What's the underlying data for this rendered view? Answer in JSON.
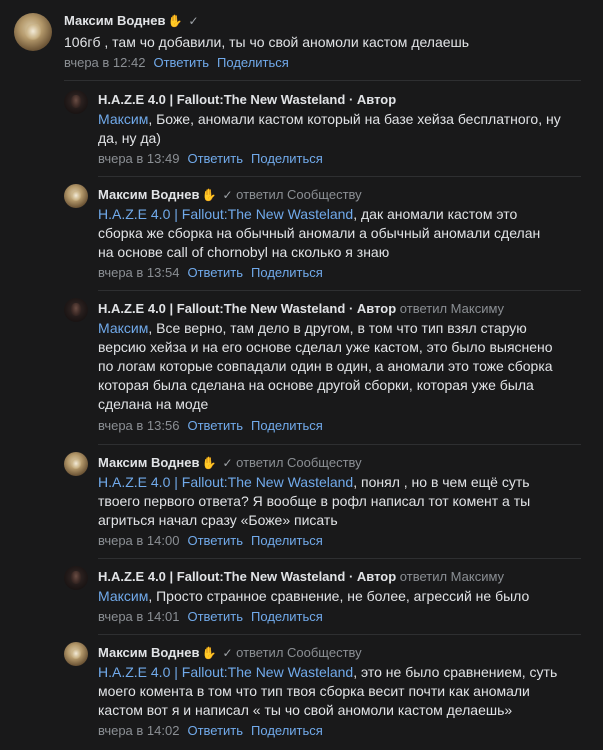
{
  "top": {
    "author": "Максим Воднев",
    "text": "106гб , там чо добавили, ты чо свой аномоли кастом делаешь",
    "time": "вчера в 12:42",
    "reply": "Ответить",
    "share": "Поделиться"
  },
  "replies": [
    {
      "author": "H.A.Z.E 4.0 | Fallout:The New Wasteland",
      "role": "· Автор",
      "replied": "",
      "mention": "Максим",
      "text": ", Боже, аномали кастом который на базе хейза бесплатного, ну да, ну да)",
      "time": "вчера в 13:49",
      "reply": "Ответить",
      "share": "Поделиться"
    },
    {
      "author": "Максим Воднев",
      "role": "",
      "replied": "ответил Сообществу",
      "mention": "H.A.Z.E 4.0 | Fallout:The New Wasteland",
      "text": ", дак аномали кастом это сборка же сборка на обычный аномали а обычный аномали сделан на основе call of chornobyl на сколько я знаю",
      "time": "вчера в 13:54",
      "reply": "Ответить",
      "share": "Поделиться"
    },
    {
      "author": "H.A.Z.E 4.0 | Fallout:The New Wasteland",
      "role": "· Автор",
      "replied": "ответил Максиму",
      "mention": "Максим",
      "text": ", Все верно, там дело в другом, в том что тип взял старую версию хейза и на его основе сделал уже кастом, это было выяснено по логам которые совпадали один в один, а аномали это тоже сборка которая была сделана на основе другой сборки, которая уже была сделана на моде",
      "time": "вчера в 13:56",
      "reply": "Ответить",
      "share": "Поделиться"
    },
    {
      "author": "Максим Воднев",
      "role": "",
      "replied": "ответил Сообществу",
      "mention": "H.A.Z.E 4.0 | Fallout:The New Wasteland",
      "text": ", понял , но в чем ещё суть твоего первого ответа? Я вообще в рофл написал тот комент а ты агриться начал сразу «Боже» писать",
      "time": "вчера в 14:00",
      "reply": "Ответить",
      "share": "Поделиться"
    },
    {
      "author": "H.A.Z.E 4.0 | Fallout:The New Wasteland",
      "role": "· Автор",
      "replied": "ответил Максиму",
      "mention": "Максим",
      "text": ", Просто странное сравнение, не более, агрессий не было",
      "time": "вчера в 14:01",
      "reply": "Ответить",
      "share": "Поделиться"
    },
    {
      "author": "Максим Воднев",
      "role": "",
      "replied": "ответил Сообществу",
      "mention": "H.A.Z.E 4.0 | Fallout:The New Wasteland",
      "text": ", это не было сравнением, суть моего комента в том что тип твоя сборка весит почти как аномали кастом вот я и написал « ты чо свой аномоли кастом делаешь»",
      "time": "вчера в 14:02",
      "reply": "Ответить",
      "share": "Поделиться"
    }
  ],
  "colors": {
    "background": "#19191a",
    "link": "#71aaeb",
    "muted": "#8b8f94",
    "text": "#e1e3e6"
  },
  "icons": {
    "hand": "waving-hand-emoji-icon",
    "verified": "checkmark-icon"
  }
}
